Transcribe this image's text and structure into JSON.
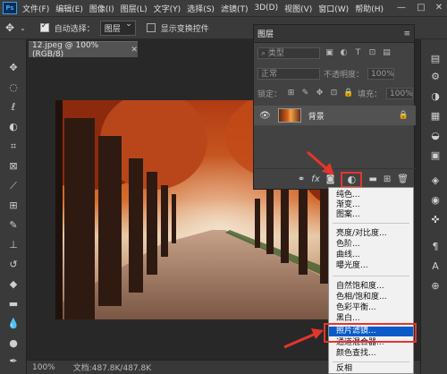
{
  "app": {
    "logo": "Ps"
  },
  "menu": [
    "文件(F)",
    "编辑(E)",
    "图像(I)",
    "图层(L)",
    "文字(Y)",
    "选择(S)",
    "滤镜(T)",
    "3D(D)",
    "视图(V)",
    "窗口(W)",
    "帮助(H)"
  ],
  "options": {
    "auto_select_label": "自动选择：",
    "auto_select_value": "图层",
    "show_transform_label": "显示变换控件"
  },
  "document": {
    "tab_title": "12.jpeg @ 100%(RGB/8)"
  },
  "status": {
    "zoom": "100%",
    "doc_size": "文档:487.8K/487.8K"
  },
  "layers_panel": {
    "title": "图层",
    "filter_placeholder": "类型",
    "blend_mode": "正常",
    "opacity_label": "不透明度：",
    "opacity_value": "100%",
    "lock_label": "锁定：",
    "fill_label": "填充：",
    "fill_value": "100%",
    "layer_name": "背景",
    "footer_fx": "fx"
  },
  "adjustment_menu": {
    "items": [
      "纯色...",
      "渐变...",
      "图案...",
      "亮度/对比度...",
      "色阶...",
      "曲线...",
      "曝光度...",
      "自然饱和度...",
      "色相/饱和度...",
      "色彩平衡...",
      "黑白...",
      "照片滤镜...",
      "通道混合器...",
      "颜色查找...",
      "反相"
    ],
    "highlighted": "照片滤镜..."
  },
  "colors": {
    "accent_red": "#e5352b",
    "highlight_blue": "#0a5bc9",
    "ps_blue": "#31a8ff"
  }
}
